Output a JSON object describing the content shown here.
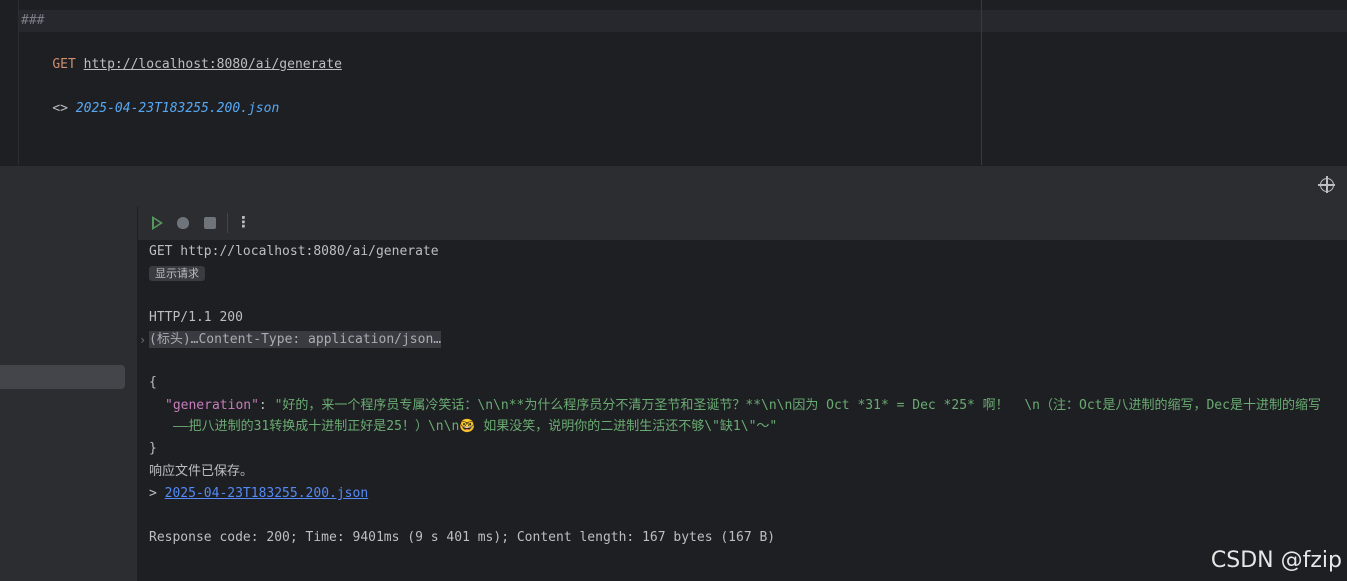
{
  "editor": {
    "separator_line": "###",
    "method": "GET",
    "url": "http://localhost:8080/ai/generate",
    "ref_prefix": "<>",
    "ref_file": "2025-04-23T183255.200.json"
  },
  "toolbar": {
    "run_icon": "play-icon",
    "debug_icon": "bug-icon",
    "stop_icon": "stop-icon",
    "more_icon": "more-vertical-icon",
    "more_glyph": "⋮",
    "locate_icon": "crosshair-icon"
  },
  "output": {
    "request_line": "GET http://localhost:8080/ai/generate",
    "show_request_label": "显示请求",
    "status_line": "HTTP/1.1 200",
    "headers_folded": "(标头)…Content-Type: application/json…",
    "brace_open": "{",
    "json_key": "\"generation\"",
    "json_colon": ": ",
    "json_value_line1": "\"好的，来一个程序员专属冷笑话：\\n\\n**为什么程序员分不清万圣节和圣诞节？**\\n\\n因为 Oct *31* = Dec *25* 啊！  \\n（注：Oct是八进制的缩写，Dec是十进制的缩写",
    "json_value_line2": "——把八进制的31转换成十进制正好是25！）\\n\\n🤓 如果没笑，说明你的二进制生活还不够\\\"缺1\\\"～\"",
    "brace_close": "}",
    "saved_message": "响应文件已保存。",
    "saved_prefix": "> ",
    "saved_file": "2025-04-23T183255.200.json",
    "summary": "Response code: 200; Time: 9401ms (9 s 401 ms); Content length: 167 bytes (167 B)"
  },
  "watermark": "CSDN @fzip",
  "colors": {
    "background": "#1e1f22",
    "panel": "#2b2d30",
    "keyword": "#cf8e6d",
    "json_key": "#c77dbb",
    "json_string": "#6aab73",
    "link": "#548af7",
    "run_green": "#57965c"
  }
}
